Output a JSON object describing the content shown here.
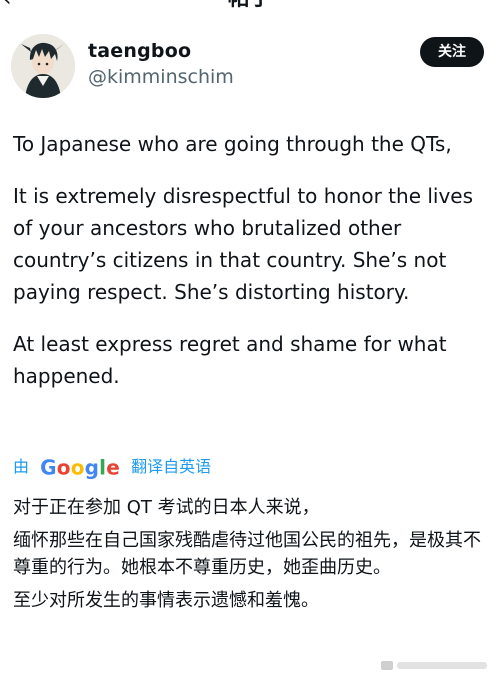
{
  "header": {
    "back_icon": "chevron-left-icon",
    "title": "帖子"
  },
  "author": {
    "name": "taengboo",
    "handle": "@kimminschim",
    "avatar": "avatar-icon"
  },
  "follow_button": {
    "label": "关注"
  },
  "tweet": {
    "paragraphs": [
      "To Japanese who are going through the QTs,",
      "It is extremely disrespectful to honor the lives of your ancestors who brutalized other country’s citizens in that country. She’s not paying respect. She’s distorting history.",
      "At least express regret and shame for what happened."
    ]
  },
  "translation": {
    "prefix": "由",
    "provider_letters": [
      "G",
      "o",
      "o",
      "g",
      "l",
      "e"
    ],
    "suffix": "翻译自英语",
    "paragraphs": [
      "对于正在参加 QT 考试的日本人来说，",
      "缅怀那些在自己国家残酷虐待过他国公民的祖先，是极其不尊重的行为。她根本不尊重历史，她歪曲历史。",
      "至少对所发生的事情表示遗憾和羞愧。"
    ]
  },
  "colors": {
    "text": "#0f1419",
    "secondary": "#536471",
    "link": "#1d9bf0",
    "button_bg": "#0f1419",
    "google_blue": "#4285f4",
    "google_red": "#ea4335",
    "google_yellow": "#fbbc05",
    "google_green": "#34a853"
  }
}
